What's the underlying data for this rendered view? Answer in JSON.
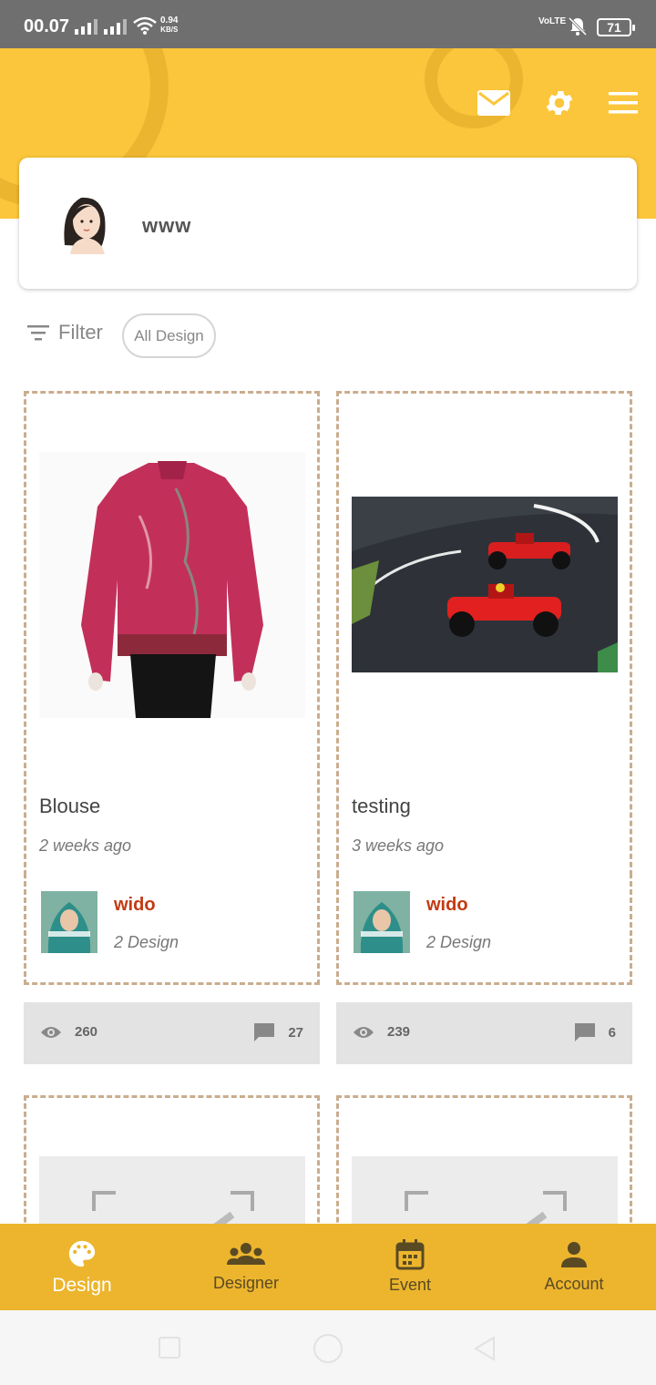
{
  "status_bar": {
    "time": "00.07",
    "speed_value": "0.94",
    "speed_unit": "KB/S",
    "network": "VoLTE",
    "battery": "71"
  },
  "header": {
    "icons": [
      "mail-icon",
      "settings-icon",
      "menu-icon"
    ],
    "accent_color": "#fbc63b"
  },
  "profile": {
    "name": "www"
  },
  "filter": {
    "label": "Filter",
    "chip": "All Design"
  },
  "designs": [
    {
      "title": "Blouse",
      "date": "2 weeks ago",
      "author": "wido",
      "author_designs": "2 Design",
      "views": "260",
      "comments": "27"
    },
    {
      "title": "testing",
      "date": "3 weeks ago",
      "author": "wido",
      "author_designs": "2 Design",
      "views": "239",
      "comments": "6"
    }
  ],
  "bottom_nav": {
    "items": [
      {
        "label": "Design",
        "icon": "palette-icon",
        "active": true
      },
      {
        "label": "Designer",
        "icon": "group-icon",
        "active": false
      },
      {
        "label": "Event",
        "icon": "calendar-icon",
        "active": false
      },
      {
        "label": "Account",
        "icon": "person-icon",
        "active": false
      }
    ],
    "color": "#ecb52d"
  }
}
